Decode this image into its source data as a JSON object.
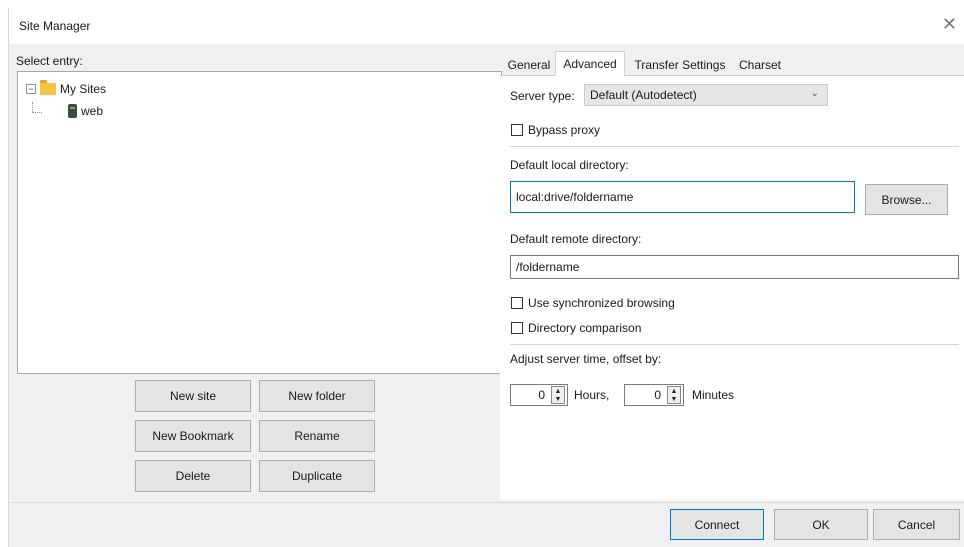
{
  "window": {
    "title": "Site Manager",
    "close_glyph": "✕"
  },
  "left": {
    "select_entry_label": "Select entry:",
    "tree": [
      {
        "label": "My Sites",
        "icon": "folder-icon",
        "expander": "−"
      },
      {
        "label": "web",
        "icon": "server-icon"
      }
    ],
    "buttons": {
      "new_site": "New site",
      "new_folder": "New folder",
      "new_bookmark": "New Bookmark",
      "rename": "Rename",
      "delete": "Delete",
      "duplicate": "Duplicate"
    }
  },
  "tabs": [
    "General",
    "Advanced",
    "Transfer Settings",
    "Charset"
  ],
  "active_tab": "Advanced",
  "advanced": {
    "server_type_label": "Server type:",
    "server_type_value": "Default (Autodetect)",
    "bypass_proxy_label": "Bypass proxy",
    "bypass_proxy_checked": false,
    "local_dir_label": "Default local directory:",
    "local_dir_value": "local:drive/foldername",
    "browse_label": "Browse...",
    "remote_dir_label": "Default remote directory:",
    "remote_dir_value": "/foldername",
    "sync_browsing_label": "Use synchronized browsing",
    "sync_browsing_checked": false,
    "dir_comparison_label": "Directory comparison",
    "dir_comparison_checked": false,
    "adjust_time_label": "Adjust server time, offset by:",
    "hours_value": "0",
    "hours_label": "Hours,",
    "minutes_value": "0",
    "minutes_label": "Minutes"
  },
  "footer": {
    "connect": "Connect",
    "ok": "OK",
    "cancel": "Cancel"
  },
  "colors": {
    "focus_border": "#0078d7",
    "folder": "#f5c542",
    "dialog_bg": "#f0f0f0"
  }
}
